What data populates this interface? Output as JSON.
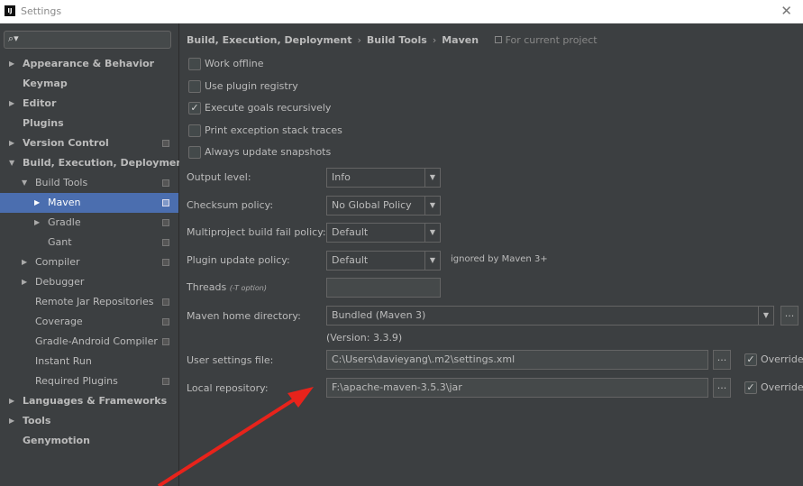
{
  "window": {
    "title": "Settings",
    "close_glyph": "✕"
  },
  "sidebar": {
    "search_placeholder": "",
    "items": [
      {
        "label": "Appearance & Behavior"
      },
      {
        "label": "Keymap"
      },
      {
        "label": "Editor"
      },
      {
        "label": "Plugins"
      },
      {
        "label": "Version Control"
      },
      {
        "label": "Build, Execution, Deployment"
      },
      {
        "label": "Build Tools"
      },
      {
        "label": "Maven"
      },
      {
        "label": "Gradle"
      },
      {
        "label": "Gant"
      },
      {
        "label": "Compiler"
      },
      {
        "label": "Debugger"
      },
      {
        "label": "Remote Jar Repositories"
      },
      {
        "label": "Coverage"
      },
      {
        "label": "Gradle-Android Compiler"
      },
      {
        "label": "Instant Run"
      },
      {
        "label": "Required Plugins"
      },
      {
        "label": "Languages & Frameworks"
      },
      {
        "label": "Tools"
      },
      {
        "label": "Genymotion"
      }
    ]
  },
  "breadcrumb": {
    "items": [
      "Build, Execution, Deployment",
      "Build Tools",
      "Maven"
    ],
    "separator": "›",
    "scope": "For current project"
  },
  "options": {
    "checkboxes": [
      {
        "label": "Work offline",
        "checked": false
      },
      {
        "label": "Use plugin registry",
        "checked": false
      },
      {
        "label": "Execute goals recursively",
        "checked": true
      },
      {
        "label": "Print exception stack traces",
        "checked": false
      },
      {
        "label": "Always update snapshots",
        "checked": false
      }
    ],
    "output_level": {
      "label": "Output level:",
      "value": "Info"
    },
    "checksum_policy": {
      "label": "Checksum policy:",
      "value": "No Global Policy"
    },
    "multiproject_fail_policy": {
      "label": "Multiproject build fail policy:",
      "value": "Default"
    },
    "plugin_update_policy": {
      "label": "Plugin update policy:",
      "value": "Default",
      "note": "ignored by Maven 3+"
    },
    "threads": {
      "label": "Threads",
      "hint": "(-T option)",
      "value": ""
    },
    "maven_home": {
      "label": "Maven home directory:",
      "value": "Bundled (Maven 3)",
      "version": "(Version: 3.3.9)"
    },
    "user_settings": {
      "label": "User settings file:",
      "value": "C:\\Users\\davieyang\\.m2\\settings.xml",
      "override_label": "Override",
      "override_checked": true
    },
    "local_repository": {
      "label": "Local repository:",
      "value": "F:\\apache-maven-3.5.3\\jar",
      "override_label": "Override",
      "override_checked": true
    }
  },
  "colors": {
    "accent_selection": "#4b6eaf",
    "annotation_arrow": "#e8231b"
  },
  "icons": {
    "dropdown": "▼",
    "browse": "...",
    "check": "✓",
    "tree_expanded": "▼",
    "tree_collapsed": "▶",
    "search": "🔍"
  }
}
